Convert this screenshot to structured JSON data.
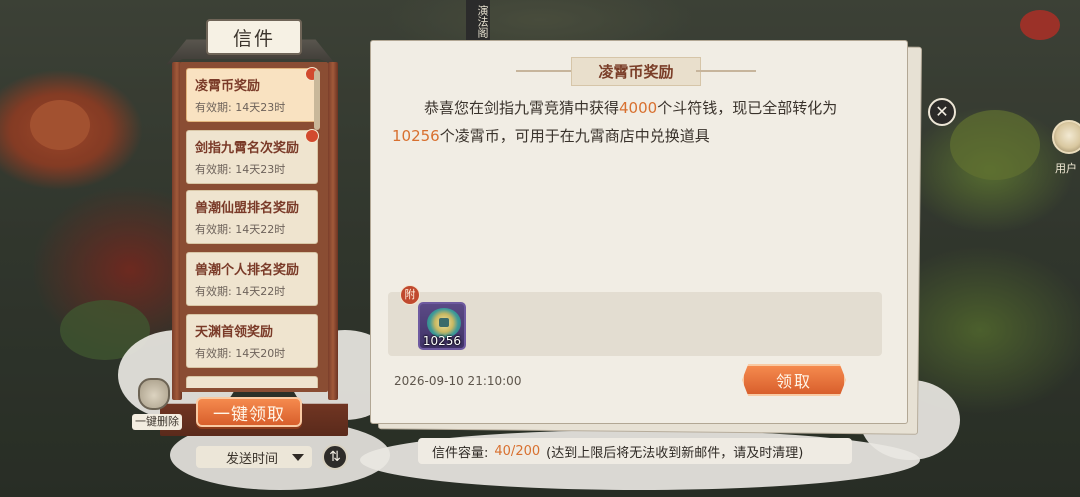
{
  "scene": {
    "temple_sign": "演法阁",
    "user_icon_label": "用户"
  },
  "mail_panel": {
    "title": "信件",
    "items": [
      {
        "title": "凌霄币奖励",
        "expiry": "有效期: 14天23时",
        "badge": true,
        "selected": true
      },
      {
        "title": "剑指九霄名次奖励",
        "expiry": "有效期: 14天23时",
        "badge": true,
        "selected": false
      },
      {
        "title": "兽潮仙盟排名奖励",
        "expiry": "有效期: 14天22时",
        "badge": false,
        "selected": false
      },
      {
        "title": "兽潮个人排名奖励",
        "expiry": "有效期: 14天22时",
        "badge": false,
        "selected": false
      },
      {
        "title": "天渊首领奖励",
        "expiry": "有效期: 14天20时",
        "badge": false,
        "selected": false
      }
    ],
    "claim_all_label": "一键领取",
    "delete_label": "一键删除",
    "sort_label": "发送时间",
    "sort_toggle_icon": "⇅"
  },
  "detail": {
    "title": "凌霄币奖励",
    "body_part1": "恭喜您在剑指九霄竞猜中获得",
    "body_num1": "4000",
    "body_part2": "个斗符钱，现已全部转化为",
    "body_num2": "10256",
    "body_part3": "个凌霄币，可用于在九霄商店中兑换道具",
    "attach_tag": "附",
    "attachment_count": "10256",
    "sent_time": "2026-09-10 21:10:00",
    "claim_label": "领取",
    "close_icon": "✕"
  },
  "footer": {
    "capacity_label": "信件容量:",
    "capacity_value": "40/200",
    "capacity_note": "(达到上限后将无法收到新邮件，请及时清理)"
  },
  "colors": {
    "accent": "#d8702f",
    "button": "#e97440",
    "title_red": "#7a3a28"
  }
}
